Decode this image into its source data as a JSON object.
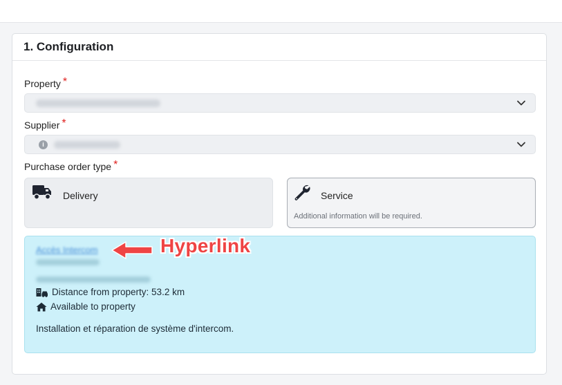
{
  "section": {
    "title": "1. Configuration"
  },
  "fields": {
    "property": {
      "label": "Property",
      "required_mark": "*"
    },
    "supplier": {
      "label": "Supplier",
      "required_mark": "*"
    },
    "po_type": {
      "label": "Purchase order type",
      "required_mark": "*"
    }
  },
  "po_types": {
    "delivery": {
      "label": "Delivery"
    },
    "service": {
      "label": "Service",
      "note": "Additional information will be required."
    }
  },
  "supplier_details": {
    "link_text": "Accès Intercom",
    "distance": "Distance from property: 53.2 km",
    "availability": "Available to property",
    "description": "Installation et réparation de système d'intercom."
  },
  "annotation": {
    "text": "Hyperlink",
    "color": "#ef4444"
  },
  "colors": {
    "required": "#e0211f",
    "panel_bg": "#cdf1fa",
    "link": "#4a8fd8"
  },
  "icons": {
    "delivery": "truck-icon",
    "service": "wrench-icon",
    "distance": "building-car-icon",
    "availability": "home-icon"
  }
}
